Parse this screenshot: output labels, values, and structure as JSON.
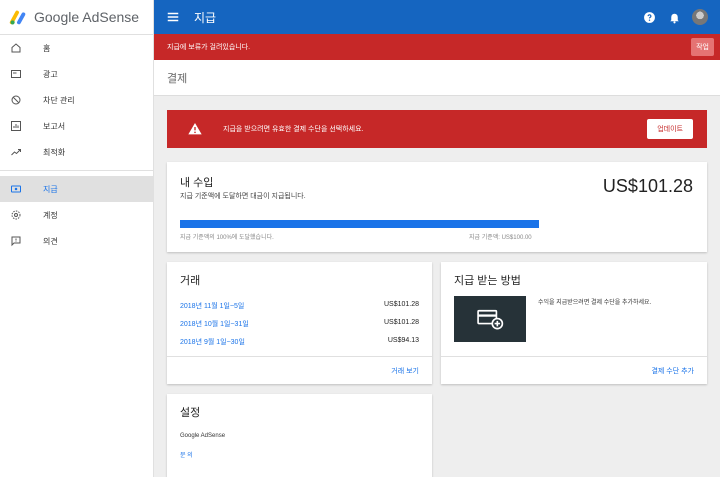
{
  "app": {
    "logo_text": "Google AdSense"
  },
  "sidebar": {
    "items": [
      {
        "label": "홈",
        "icon": "home-icon"
      },
      {
        "label": "광고",
        "icon": "ads-icon"
      },
      {
        "label": "차단 관리",
        "icon": "block-icon"
      },
      {
        "label": "보고서",
        "icon": "reports-icon"
      },
      {
        "label": "최적화",
        "icon": "optimize-icon"
      },
      {
        "label": "지급",
        "icon": "payments-icon"
      },
      {
        "label": "계정",
        "icon": "gear-icon"
      },
      {
        "label": "의견",
        "icon": "feedback-icon"
      }
    ],
    "active_item": "지급"
  },
  "topbar": {
    "title": "지급"
  },
  "alert_bar": {
    "text": "지급에 보류가 걸려있습니다.",
    "action_label": "작업"
  },
  "page": {
    "title": "결제"
  },
  "warning": {
    "text": "지급을 받으려면 유효한 결제 수단을 선택하세요.",
    "button_label": "업데이트"
  },
  "earnings": {
    "title": "내 수입",
    "subtitle": "지급 기준액에 도달하면 대금이 지급됩니다.",
    "amount": "US$101.28",
    "progress_percent": 100,
    "progress_left_label": "지급 기준액의 100%에 도달했습니다.",
    "progress_right_label": "지급 기준액: US$100.00"
  },
  "transactions": {
    "title": "거래",
    "rows": [
      {
        "date": "2018년 11월 1일~5일",
        "amount": "US$101.28"
      },
      {
        "date": "2018년 10월 1일~31일",
        "amount": "US$101.28"
      },
      {
        "date": "2018년 9월 1일~30일",
        "amount": "US$94.13"
      }
    ],
    "footer_link": "거래 보기"
  },
  "payment_method": {
    "title": "지급 받는 방법",
    "text": "수익을 지급받으려면 결제 수단을 추가하세요.",
    "footer_link": "결제 수단 추가"
  },
  "settings": {
    "title": "설정",
    "line1": "Google AdSense",
    "line2": "문 의"
  },
  "colors": {
    "topbar": "#1565c0",
    "alert": "#c62828",
    "link": "#1a73e8",
    "payment_box": "#263238"
  }
}
